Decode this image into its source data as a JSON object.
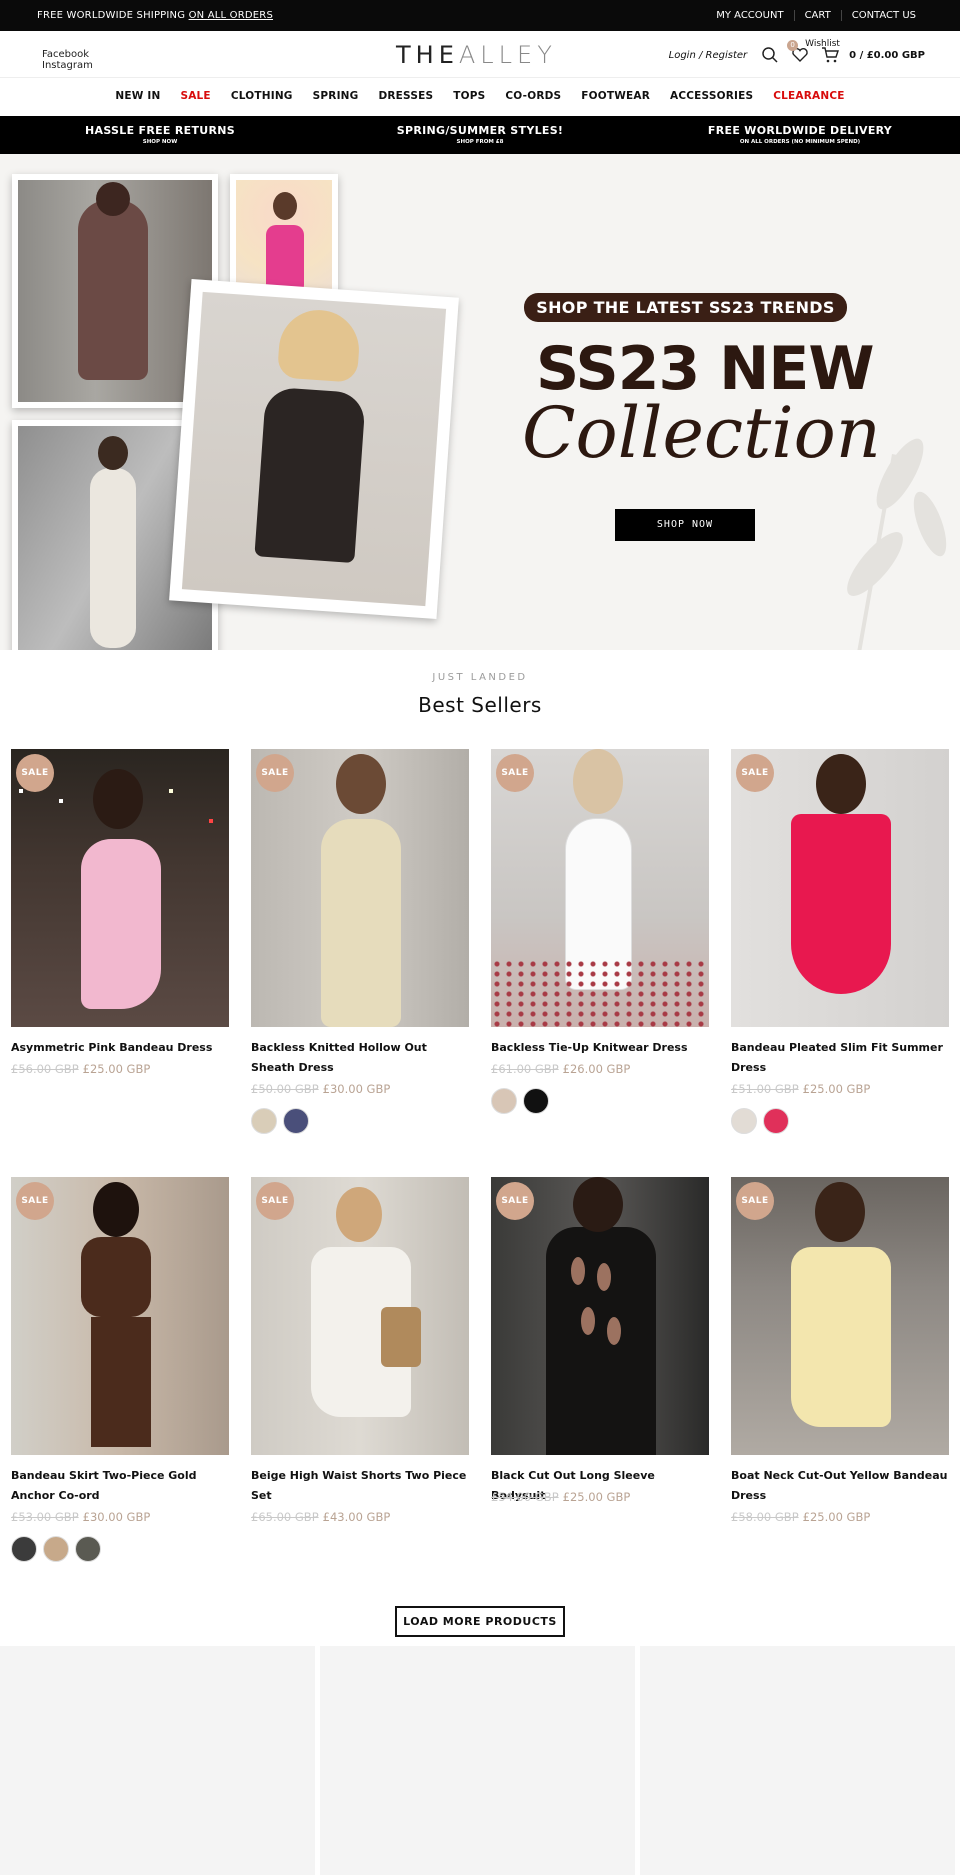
{
  "topbar": {
    "shipping_text": "FREE WORLDWIDE SHIPPING",
    "shipping_link": "ON ALL ORDERS",
    "links": [
      "MY ACCOUNT",
      "CART",
      "CONTACT US"
    ]
  },
  "header": {
    "social": [
      "Facebook",
      "Instagram"
    ],
    "logo_bold": "THE",
    "logo_light": "ALLEY",
    "login": "Login / Register",
    "wishlist_label": "Wishlist",
    "wishlist_count": "0",
    "cart_text": "0 / £0.00 GBP"
  },
  "nav": [
    "NEW IN",
    "SALE",
    "CLOTHING",
    "SPRING",
    "DRESSES",
    "TOPS",
    "CO-ORDS",
    "FOOTWEAR",
    "ACCESSORIES",
    "CLEARANCE"
  ],
  "promos": [
    {
      "title": "HASSLE FREE RETURNS",
      "sub": "SHOP NOW"
    },
    {
      "title": "SPRING/SUMMER STYLES!",
      "sub": "SHOP FROM £8"
    },
    {
      "title": "FREE WORLDWIDE DELIVERY",
      "sub": "ON ALL ORDERS (NO MINIMUM SPEND)"
    }
  ],
  "hero": {
    "pill": "SHOP THE LATEST SS23 TRENDS",
    "headline": "SS23 NEW",
    "script": "Collection",
    "button": "SHOP NOW"
  },
  "section": {
    "sub": "JUST LANDED",
    "title": "Best Sellers"
  },
  "sale_label": "SALE",
  "products": [
    {
      "name": "Asymmetric Pink Bandeau Dress",
      "old": "£56.00 GBP",
      "price": "£25.00 GBP"
    },
    {
      "name": "Backless Knitted Hollow Out Sheath Dress",
      "old": "£50.00 GBP",
      "price": "£30.00 GBP"
    },
    {
      "name": "Backless Tie-Up Knitwear Dress",
      "old": "£61.00 GBP",
      "price": "£26.00 GBP"
    },
    {
      "name": "Bandeau Pleated Slim Fit Summer Dress",
      "old": "£51.00 GBP",
      "price": "£25.00 GBP"
    },
    {
      "name": "Bandeau Skirt Two-Piece Gold Anchor Co-ord",
      "old": "£53.00 GBP",
      "price": "£30.00 GBP"
    },
    {
      "name": "Beige High Waist Shorts Two Piece Set",
      "old": "£65.00 GBP",
      "price": "£43.00 GBP"
    },
    {
      "name": "Black Cut Out Long Sleeve Bodysuit",
      "old": "£54.00 GBP",
      "price": "£25.00 GBP"
    },
    {
      "name": "Boat Neck Cut-Out Yellow Bandeau Dress",
      "old": "£58.00 GBP",
      "price": "£25.00 GBP"
    }
  ],
  "load_more": "LOAD MORE PRODUCTS",
  "colors": {
    "accent": "#d1a68d",
    "sale_red": "#d80c0c",
    "hero_brown": "#2c1810"
  }
}
